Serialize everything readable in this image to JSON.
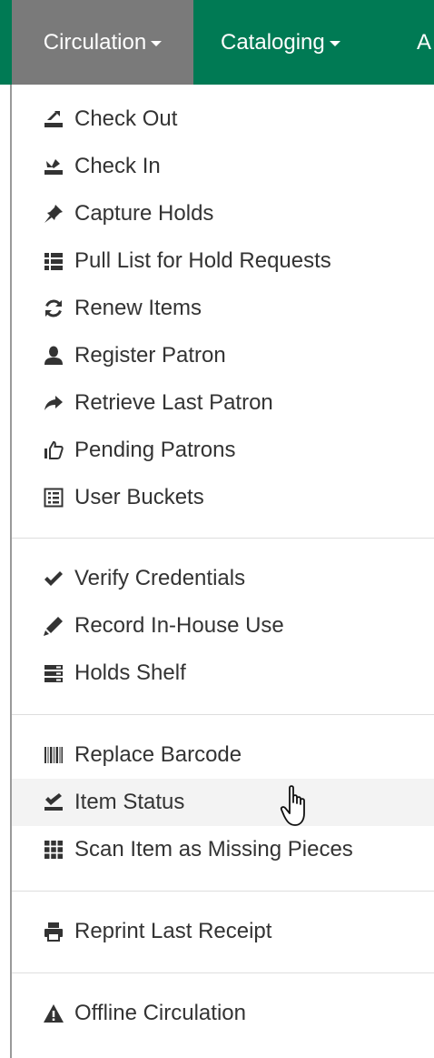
{
  "navbar": {
    "brand_color": "#007a54",
    "active_color": "#7a7a7a",
    "items": [
      {
        "label": "Circulation",
        "icon": "caret-down-icon",
        "active": true
      },
      {
        "label": "Cataloging",
        "icon": "caret-down-icon",
        "active": false
      },
      {
        "label": "A",
        "active": false
      }
    ]
  },
  "menu": {
    "sections": [
      {
        "items": [
          {
            "label": "Check Out",
            "icon": "check-out-icon"
          },
          {
            "label": "Check In",
            "icon": "check-in-icon"
          },
          {
            "label": "Capture Holds",
            "icon": "pushpin-icon"
          },
          {
            "label": "Pull List for Hold Requests",
            "icon": "list-icon"
          },
          {
            "label": "Renew Items",
            "icon": "refresh-icon"
          },
          {
            "label": "Register Patron",
            "icon": "user-icon"
          },
          {
            "label": "Retrieve Last Patron",
            "icon": "share-arrow-icon"
          },
          {
            "label": "Pending Patrons",
            "icon": "thumbs-up-icon"
          },
          {
            "label": "User Buckets",
            "icon": "list-alt-icon"
          }
        ]
      },
      {
        "items": [
          {
            "label": "Verify Credentials",
            "icon": "checkmark-icon"
          },
          {
            "label": "Record In-House Use",
            "icon": "pencil-icon"
          },
          {
            "label": "Holds Shelf",
            "icon": "tasks-icon"
          }
        ]
      },
      {
        "items": [
          {
            "label": "Replace Barcode",
            "icon": "barcode-icon"
          },
          {
            "label": "Item Status",
            "icon": "item-status-icon",
            "hovered": true
          },
          {
            "label": "Scan Item as Missing Pieces",
            "icon": "grid-icon"
          }
        ]
      },
      {
        "items": [
          {
            "label": "Reprint Last Receipt",
            "icon": "print-icon"
          }
        ]
      },
      {
        "items": [
          {
            "label": "Offline Circulation",
            "icon": "warning-icon"
          }
        ]
      }
    ]
  },
  "cursor": {
    "icon": "hand-pointer-icon"
  }
}
